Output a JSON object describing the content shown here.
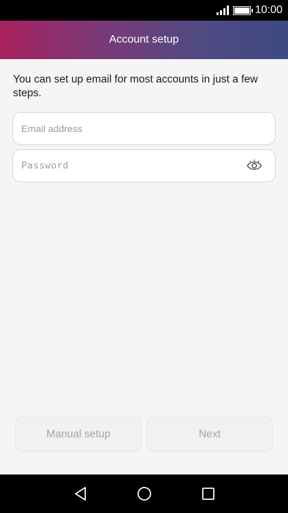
{
  "status_bar": {
    "time": "10:00",
    "icons": [
      "signal-icon",
      "battery-icon"
    ]
  },
  "app_bar": {
    "title": "Account setup",
    "gradient": [
      "#a8205e",
      "#3e4a80"
    ]
  },
  "intro_text": "You can set up email for most accounts in just a few steps.",
  "form": {
    "email_placeholder": "Email address",
    "email_value": "",
    "password_placeholder": "Password",
    "password_value": "",
    "password_toggle_icon": "eye-icon"
  },
  "buttons": {
    "manual_setup": "Manual setup",
    "next": "Next"
  },
  "nav_bar": {
    "icons": [
      "back-icon",
      "home-icon",
      "recents-icon"
    ]
  }
}
